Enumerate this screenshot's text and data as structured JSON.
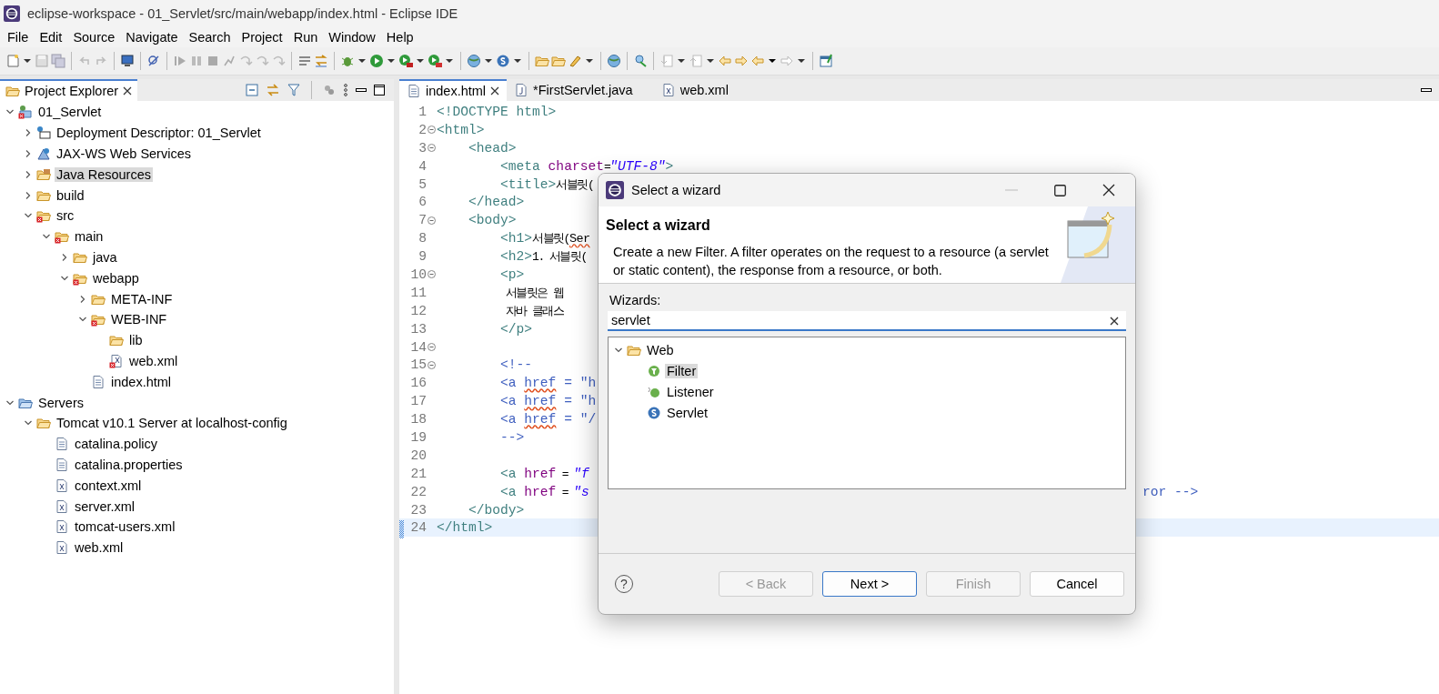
{
  "window": {
    "title": "eclipse-workspace - 01_Servlet/src/main/webapp/index.html - Eclipse IDE"
  },
  "menu": [
    "File",
    "Edit",
    "Source",
    "Navigate",
    "Search",
    "Project",
    "Run",
    "Window",
    "Help"
  ],
  "explorer": {
    "tab": "Project Explorer",
    "tree": [
      {
        "label": "01_Servlet",
        "kind": "project",
        "expanded": true,
        "selected": false,
        "children": [
          {
            "label": "Deployment Descriptor: 01_Servlet",
            "kind": "descriptor",
            "expanded": false,
            "selected": false
          },
          {
            "label": "JAX-WS Web Services",
            "kind": "services",
            "expanded": false,
            "selected": false
          },
          {
            "label": "Java Resources",
            "kind": "resources",
            "expanded": false,
            "selected": true
          },
          {
            "label": "build",
            "kind": "folder",
            "expanded": false,
            "selected": false
          },
          {
            "label": "src",
            "kind": "error-folder",
            "expanded": true,
            "selected": false,
            "children": [
              {
                "label": "main",
                "kind": "error-folder",
                "expanded": true,
                "selected": false,
                "children": [
                  {
                    "label": "java",
                    "kind": "folder",
                    "expanded": false,
                    "selected": false
                  },
                  {
                    "label": "webapp",
                    "kind": "error-folder",
                    "expanded": true,
                    "selected": false,
                    "children": [
                      {
                        "label": "META-INF",
                        "kind": "folder",
                        "expanded": false,
                        "selected": false
                      },
                      {
                        "label": "WEB-INF",
                        "kind": "error-folder",
                        "expanded": true,
                        "selected": false,
                        "children": [
                          {
                            "label": "lib",
                            "kind": "folder",
                            "selected": false
                          },
                          {
                            "label": "web.xml",
                            "kind": "error-xml",
                            "selected": false
                          }
                        ]
                      },
                      {
                        "label": "index.html",
                        "kind": "html",
                        "selected": false
                      }
                    ]
                  }
                ]
              }
            ]
          }
        ]
      },
      {
        "label": "Servers",
        "kind": "server-folder",
        "expanded": true,
        "selected": false,
        "children": [
          {
            "label": "Tomcat v10.1 Server at localhost-config",
            "kind": "folder",
            "expanded": true,
            "selected": false,
            "children": [
              {
                "label": "catalina.policy",
                "kind": "text",
                "selected": false
              },
              {
                "label": "catalina.properties",
                "kind": "text",
                "selected": false
              },
              {
                "label": "context.xml",
                "kind": "xml",
                "selected": false
              },
              {
                "label": "server.xml",
                "kind": "xml",
                "selected": false
              },
              {
                "label": "tomcat-users.xml",
                "kind": "xml",
                "selected": false
              },
              {
                "label": "web.xml",
                "kind": "xml",
                "selected": false
              }
            ]
          }
        ]
      }
    ]
  },
  "editor": {
    "tabs": [
      {
        "label": "index.html",
        "kind": "html",
        "selected": true
      },
      {
        "label": "*FirstServlet.java",
        "kind": "java",
        "selected": false
      },
      {
        "label": "web.xml",
        "kind": "xml",
        "selected": false
      }
    ],
    "lines": [
      {
        "number": "1",
        "foldable": false,
        "current": false,
        "segments": [
          {
            "text": "<!DOCTYPE html>",
            "kind": "tag"
          }
        ]
      },
      {
        "number": "2",
        "foldable": true,
        "current": false,
        "segments": [
          {
            "text": "<html>",
            "kind": "tag"
          }
        ]
      },
      {
        "number": "3",
        "foldable": true,
        "current": false,
        "segments": [
          {
            "text": "    <head>",
            "kind": "tag"
          }
        ]
      },
      {
        "number": "4",
        "foldable": false,
        "current": false,
        "segments": [
          {
            "text": "        <meta",
            "kind": "tag"
          },
          {
            "text": " charset",
            "kind": "attr"
          },
          {
            "text": "=",
            "kind": "text"
          },
          {
            "text": "\"UTF-8\"",
            "kind": "value"
          },
          {
            "text": ">",
            "kind": "tag"
          }
        ]
      },
      {
        "number": "5",
        "foldable": false,
        "current": false,
        "segments": [
          {
            "text": "        <title>",
            "kind": "tag"
          },
          {
            "text": "서블릿(",
            "kind": "text"
          }
        ]
      },
      {
        "number": "6",
        "foldable": false,
        "current": false,
        "segments": [
          {
            "text": "    </head>",
            "kind": "tag"
          }
        ]
      },
      {
        "number": "7",
        "foldable": true,
        "current": false,
        "segments": [
          {
            "text": "    <body>",
            "kind": "tag"
          }
        ]
      },
      {
        "number": "8",
        "foldable": false,
        "current": false,
        "segments": [
          {
            "text": "        <h1>",
            "kind": "tag"
          },
          {
            "text": "서블릿(",
            "kind": "text"
          },
          {
            "text": "Ser",
            "kind": "misspelled-text"
          }
        ]
      },
      {
        "number": "9",
        "foldable": false,
        "current": false,
        "segments": [
          {
            "text": "        <h2>",
            "kind": "tag"
          },
          {
            "text": "1. 서블릿(",
            "kind": "text"
          }
        ]
      },
      {
        "number": "10",
        "foldable": true,
        "current": false,
        "segments": [
          {
            "text": "        <p>",
            "kind": "tag"
          }
        ]
      },
      {
        "number": "11",
        "foldable": false,
        "current": false,
        "segments": [
          {
            "text": "            서블릿은 웹",
            "kind": "text"
          }
        ]
      },
      {
        "number": "12",
        "foldable": false,
        "current": false,
        "segments": [
          {
            "text": "            자바 클래스",
            "kind": "text"
          }
        ]
      },
      {
        "number": "13",
        "foldable": false,
        "current": false,
        "segments": [
          {
            "text": "        </p>",
            "kind": "tag"
          }
        ]
      },
      {
        "number": "14",
        "foldable": true,
        "current": false
      },
      {
        "number": "15",
        "foldable": true,
        "current": false,
        "segments": [
          {
            "text": "        <!--",
            "kind": "comment"
          }
        ]
      },
      {
        "number": "16",
        "foldable": false,
        "current": false,
        "segments": [
          {
            "text": "        <a ",
            "kind": "comment"
          },
          {
            "text": "href",
            "kind": "misspelled"
          },
          {
            "text": " = \"h",
            "kind": "comment"
          }
        ]
      },
      {
        "number": "17",
        "foldable": false,
        "current": false,
        "segments": [
          {
            "text": "        <a ",
            "kind": "comment"
          },
          {
            "text": "href",
            "kind": "misspelled"
          },
          {
            "text": " = \"h",
            "kind": "comment"
          }
        ]
      },
      {
        "number": "18",
        "foldable": false,
        "current": false,
        "segments": [
          {
            "text": "        <a ",
            "kind": "comment"
          },
          {
            "text": "href",
            "kind": "misspelled"
          },
          {
            "text": " = \"/",
            "kind": "comment"
          }
        ]
      },
      {
        "number": "19",
        "foldable": false,
        "current": false,
        "segments": [
          {
            "text": "        -->",
            "kind": "comment"
          }
        ]
      },
      {
        "number": "20",
        "foldable": false,
        "current": false
      },
      {
        "number": "21",
        "foldable": false,
        "current": false,
        "segments": [
          {
            "text": "        <a",
            "kind": "tag"
          },
          {
            "text": " href",
            "kind": "attr"
          },
          {
            "text": " = ",
            "kind": "text"
          },
          {
            "text": "\"f",
            "kind": "value"
          }
        ]
      },
      {
        "number": "22",
        "foldable": false,
        "current": false,
        "segments": [
          {
            "text": "        <a",
            "kind": "tag"
          },
          {
            "text": " href",
            "kind": "attr"
          },
          {
            "text": " = ",
            "kind": "text"
          },
          {
            "text": "\"s",
            "kind": "value"
          }
        ],
        "tail": "ror -->"
      },
      {
        "number": "23",
        "foldable": false,
        "current": false,
        "segments": [
          {
            "text": "    </body>",
            "kind": "tag"
          }
        ]
      },
      {
        "number": "24",
        "foldable": false,
        "current": true,
        "segments": [
          {
            "text": "</html>",
            "kind": "tag"
          }
        ]
      }
    ]
  },
  "dialog": {
    "title": "Select a wizard",
    "heading": "Select a wizard",
    "description": "Create a new Filter. A filter operates on the request to a resource (a servlet or static content), the response from a resource, or both.",
    "label": "Wizards:",
    "search": {
      "value": "servlet"
    },
    "tree": [
      {
        "label": "Web",
        "kind": "folder",
        "expanded": true,
        "selected": false,
        "children": [
          {
            "label": "Filter",
            "kind": "filter",
            "selected": true
          },
          {
            "label": "Listener",
            "kind": "listener",
            "selected": false
          },
          {
            "label": "Servlet",
            "kind": "servlet",
            "selected": false
          }
        ]
      }
    ],
    "help": "?",
    "buttons": [
      {
        "label": "< Back",
        "disabled": true,
        "default": false
      },
      {
        "label": "Next >",
        "disabled": false,
        "default": true
      },
      {
        "label": "Finish",
        "disabled": true,
        "default": false
      },
      {
        "label": "Cancel",
        "disabled": false,
        "default": false
      }
    ]
  }
}
